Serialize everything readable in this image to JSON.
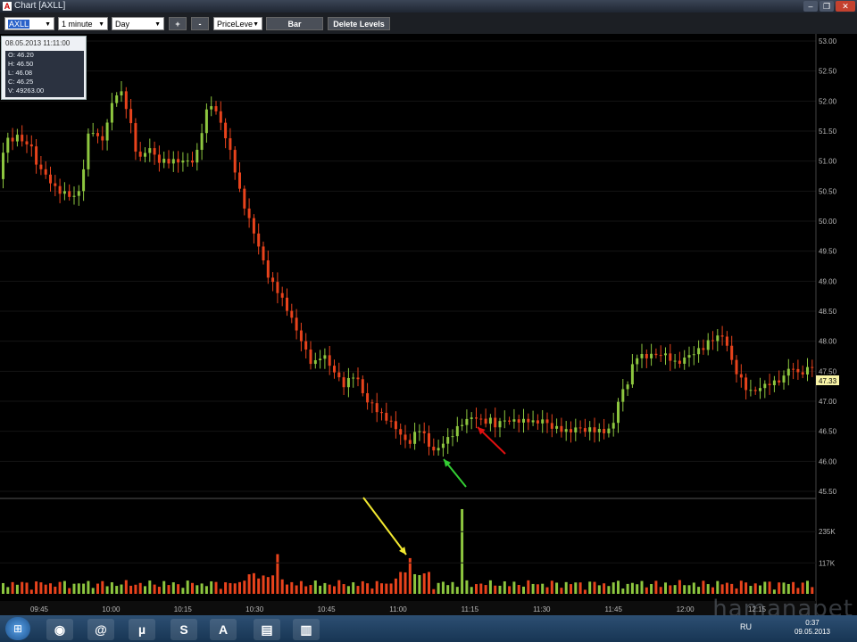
{
  "window": {
    "title": "Chart [AXLL]",
    "icon_letter": "A"
  },
  "toolbar": {
    "symbol": "AXLL",
    "interval": "1 minute",
    "range": "Day",
    "plus_label": "+",
    "minus_label": "-",
    "study": "PriceLeve",
    "type_label": "Bar",
    "delete_levels_label": "Delete Levels"
  },
  "info": {
    "datetime": "08.05.2013 11:11:00",
    "open": "O: 46.20",
    "high": "H: 46.50",
    "low": "L: 46.08",
    "close": "C: 46.25",
    "volume": "V: 49263.00"
  },
  "price_axis": {
    "labels": [
      "53.00",
      "52.50",
      "52.00",
      "51.50",
      "51.00",
      "50.50",
      "50.00",
      "49.50",
      "49.00",
      "48.50",
      "48.00",
      "47.50",
      "47.00",
      "46.50",
      "46.00",
      "45.50"
    ],
    "current": "47.33"
  },
  "volume_axis": {
    "labels": [
      "235K",
      "117K"
    ]
  },
  "time_axis": {
    "labels": [
      "09:45",
      "10:00",
      "10:15",
      "10:30",
      "10:45",
      "11:00",
      "11:15",
      "11:30",
      "11:45",
      "12:00",
      "12:15"
    ]
  },
  "colors": {
    "up": "#8dc63f",
    "down": "#e8431c",
    "background": "#000000",
    "axis_text": "#b8b8b8"
  },
  "chart_data": {
    "type": "candlestick",
    "xlabel": "",
    "ylabel": "",
    "ylim": [
      45.5,
      53.0
    ],
    "price_path": [
      [
        0,
        50.7
      ],
      [
        6,
        51.1
      ],
      [
        12,
        51.4
      ],
      [
        18,
        51.3
      ],
      [
        22,
        51.5
      ],
      [
        27,
        51.35
      ],
      [
        30,
        51.2
      ],
      [
        36,
        51.4
      ],
      [
        42,
        51.0
      ],
      [
        50,
        50.85
      ],
      [
        58,
        50.7
      ],
      [
        65,
        50.55
      ],
      [
        70,
        50.5
      ],
      [
        78,
        50.45
      ],
      [
        86,
        50.4
      ],
      [
        92,
        50.5
      ],
      [
        98,
        50.95
      ],
      [
        104,
        51.6
      ],
      [
        110,
        51.45
      ],
      [
        116,
        51.3
      ],
      [
        122,
        51.5
      ],
      [
        128,
        51.95
      ],
      [
        134,
        52.1
      ],
      [
        138,
        52.2
      ],
      [
        144,
        51.95
      ],
      [
        150,
        51.6
      ],
      [
        154,
        51.3
      ],
      [
        158,
        51.0
      ],
      [
        164,
        51.1
      ],
      [
        170,
        51.25
      ],
      [
        176,
        51.1
      ],
      [
        182,
        51.0
      ],
      [
        190,
        51.0
      ],
      [
        198,
        51.0
      ],
      [
        206,
        51.0
      ],
      [
        214,
        51.0
      ],
      [
        222,
        51.0
      ],
      [
        228,
        51.4
      ],
      [
        234,
        51.8
      ],
      [
        240,
        51.95
      ],
      [
        246,
        51.8
      ],
      [
        252,
        51.6
      ],
      [
        258,
        51.3
      ],
      [
        264,
        51.05
      ],
      [
        270,
        50.6
      ],
      [
        276,
        50.3
      ],
      [
        282,
        50.05
      ],
      [
        288,
        49.8
      ],
      [
        294,
        49.55
      ],
      [
        300,
        49.25
      ],
      [
        306,
        49.0
      ],
      [
        312,
        48.9
      ],
      [
        318,
        48.75
      ],
      [
        324,
        48.55
      ],
      [
        330,
        48.4
      ],
      [
        336,
        48.15
      ],
      [
        342,
        48.0
      ],
      [
        348,
        47.75
      ],
      [
        354,
        47.6
      ],
      [
        360,
        47.7
      ],
      [
        366,
        47.8
      ],
      [
        372,
        47.6
      ],
      [
        378,
        47.5
      ],
      [
        384,
        47.35
      ],
      [
        390,
        47.25
      ],
      [
        396,
        47.4
      ],
      [
        402,
        47.45
      ],
      [
        408,
        47.2
      ],
      [
        414,
        47.0
      ],
      [
        420,
        46.95
      ],
      [
        426,
        46.85
      ],
      [
        432,
        46.75
      ],
      [
        438,
        46.7
      ],
      [
        444,
        46.6
      ],
      [
        450,
        46.5
      ],
      [
        456,
        46.35
      ],
      [
        462,
        46.3
      ],
      [
        468,
        46.45
      ],
      [
        474,
        46.55
      ],
      [
        480,
        46.4
      ],
      [
        486,
        46.2
      ],
      [
        492,
        46.15
      ],
      [
        498,
        46.3
      ],
      [
        504,
        46.35
      ],
      [
        510,
        46.45
      ],
      [
        516,
        46.55
      ],
      [
        522,
        46.65
      ],
      [
        528,
        46.7
      ],
      [
        534,
        46.75
      ],
      [
        540,
        46.7
      ],
      [
        546,
        46.65
      ],
      [
        552,
        46.7
      ],
      [
        558,
        46.6
      ],
      [
        564,
        46.65
      ],
      [
        570,
        46.7
      ],
      [
        576,
        46.65
      ],
      [
        582,
        46.7
      ],
      [
        588,
        46.65
      ],
      [
        594,
        46.7
      ],
      [
        600,
        46.65
      ],
      [
        606,
        46.65
      ],
      [
        612,
        46.7
      ],
      [
        618,
        46.6
      ],
      [
        624,
        46.55
      ],
      [
        630,
        46.55
      ],
      [
        636,
        46.5
      ],
      [
        642,
        46.5
      ],
      [
        648,
        46.55
      ],
      [
        654,
        46.55
      ],
      [
        660,
        46.5
      ],
      [
        666,
        46.55
      ],
      [
        672,
        46.5
      ],
      [
        678,
        46.5
      ],
      [
        684,
        46.5
      ],
      [
        690,
        46.6
      ],
      [
        696,
        47.0
      ],
      [
        702,
        47.2
      ],
      [
        708,
        47.35
      ],
      [
        714,
        47.7
      ],
      [
        720,
        47.8
      ],
      [
        726,
        47.7
      ],
      [
        732,
        47.8
      ],
      [
        738,
        47.75
      ],
      [
        744,
        47.8
      ],
      [
        750,
        47.75
      ],
      [
        756,
        47.7
      ],
      [
        762,
        47.6
      ],
      [
        768,
        47.7
      ],
      [
        774,
        47.75
      ],
      [
        780,
        47.8
      ],
      [
        786,
        47.85
      ],
      [
        792,
        47.9
      ],
      [
        798,
        48.0
      ],
      [
        804,
        48.05
      ],
      [
        810,
        48.1
      ],
      [
        816,
        48.05
      ],
      [
        822,
        47.7
      ],
      [
        828,
        47.5
      ],
      [
        834,
        47.35
      ],
      [
        840,
        47.2
      ],
      [
        846,
        47.15
      ],
      [
        852,
        47.2
      ],
      [
        858,
        47.25
      ],
      [
        864,
        47.3
      ],
      [
        870,
        47.3
      ],
      [
        876,
        47.35
      ],
      [
        882,
        47.4
      ],
      [
        888,
        47.6
      ],
      [
        894,
        47.5
      ],
      [
        900,
        47.45
      ],
      [
        906,
        47.5
      ],
      [
        912,
        47.6
      ]
    ],
    "volume_ylim": [
      0,
      330
    ]
  },
  "annotations": [
    {
      "name": "yellow-arrow",
      "color": "#f2e830"
    },
    {
      "name": "green-arrow",
      "color": "#33cc33"
    },
    {
      "name": "red-arrow",
      "color": "#e01010"
    }
  ],
  "taskbar": {
    "apps": [
      {
        "name": "chrome",
        "glyph": "◉"
      },
      {
        "name": "mail-agent",
        "glyph": "@"
      },
      {
        "name": "utorrent",
        "glyph": "µ"
      },
      {
        "name": "skype",
        "glyph": "S"
      },
      {
        "name": "trading-app",
        "glyph": "A"
      },
      {
        "name": "explorer",
        "glyph": "▤"
      },
      {
        "name": "book-reader",
        "glyph": "▥"
      }
    ],
    "lang": "RU",
    "time": "0:37",
    "date": "09.05.2013"
  },
  "watermark": "hamanapet"
}
